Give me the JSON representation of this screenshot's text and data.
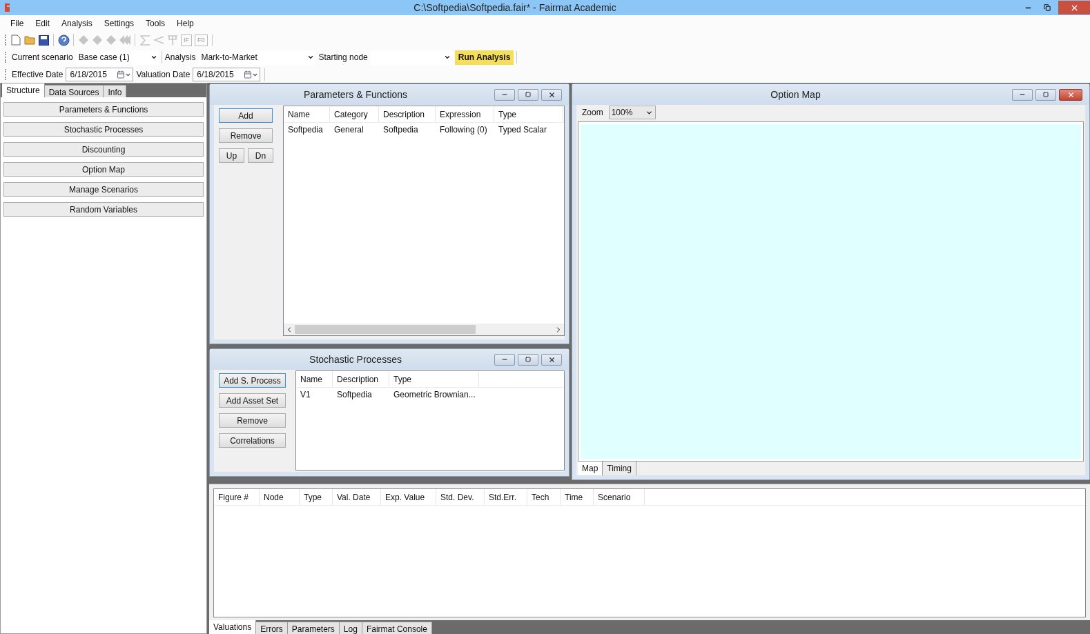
{
  "window": {
    "title": "C:\\Softpedia\\Softpedia.fair* - Fairmat Academic"
  },
  "menu": [
    "File",
    "Edit",
    "Analysis",
    "Settings",
    "Tools",
    "Help"
  ],
  "toolbar": [
    {
      "kind": "new",
      "disabled": false
    },
    {
      "kind": "open",
      "disabled": false
    },
    {
      "kind": "save",
      "disabled": false
    },
    {
      "kind": "separator"
    },
    {
      "kind": "help",
      "disabled": false
    },
    {
      "kind": "separator"
    },
    {
      "kind": "diamond",
      "disabled": true
    },
    {
      "kind": "diamond",
      "disabled": true
    },
    {
      "kind": "diamond",
      "disabled": true
    },
    {
      "kind": "rewind",
      "disabled": true
    },
    {
      "kind": "separator"
    },
    {
      "kind": "sigma",
      "disabled": true
    },
    {
      "kind": "branch",
      "disabled": true
    },
    {
      "kind": "tree",
      "disabled": true
    },
    {
      "kind": "label",
      "text": "IF",
      "disabled": true
    },
    {
      "kind": "label",
      "text": "F0",
      "disabled": true
    }
  ],
  "scenario_bar": {
    "current_scenario": {
      "label": "Current scenario",
      "value": "Base case (1)"
    },
    "analysis": {
      "label": "Analysis",
      "value": "Mark-to-Market"
    },
    "starting_node": {
      "label": "Starting node"
    },
    "run_button": "Run Analysis"
  },
  "date_bar": {
    "effective_date": {
      "label": "Effective Date",
      "value": "6/18/2015"
    },
    "valuation_date": {
      "label": "Valuation Date",
      "value": "6/18/2015"
    }
  },
  "sidebar": {
    "tabs": [
      {
        "label": "Structure",
        "selected": true
      },
      {
        "label": "Data Sources",
        "selected": false
      },
      {
        "label": "Info",
        "selected": false
      }
    ],
    "items": [
      "Parameters & Functions",
      "Stochastic Processes",
      "Discounting",
      "Option Map",
      "Manage Scenarios",
      "Random Variables"
    ]
  },
  "parameters_window": {
    "title": "Parameters & Functions",
    "buttons": [
      {
        "label": "Add",
        "focused": true
      },
      {
        "label": "Remove",
        "focused": false
      }
    ],
    "nav_buttons": [
      "Up",
      "Dn"
    ],
    "columns": [
      "Name",
      "Category",
      "Description",
      "Expression",
      "Type"
    ],
    "rows": [
      [
        "Softpedia",
        "General",
        "Softpedia",
        "Following (0)",
        "Typed Scalar"
      ]
    ]
  },
  "stochastic_window": {
    "title": "Stochastic Processes",
    "buttons": [
      {
        "label": "Add S. Process",
        "focused": true
      },
      {
        "label": "Add Asset Set",
        "focused": false
      },
      {
        "label": "Remove",
        "focused": false
      },
      {
        "label": "Correlations",
        "focused": false
      }
    ],
    "columns": [
      "Name",
      "Description",
      "Type"
    ],
    "rows": [
      [
        "V1",
        "Softpedia",
        "Geometric Brownian..."
      ]
    ]
  },
  "option_map_window": {
    "title": "Option Map",
    "zoom_label": "Zoom",
    "zoom_value": "100%",
    "tabs": [
      {
        "label": "Map",
        "selected": true
      },
      {
        "label": "Timing",
        "selected": false
      }
    ]
  },
  "results": {
    "columns": [
      "Figure #",
      "Node",
      "Type",
      "Val. Date",
      "Exp. Value",
      "Std. Dev.",
      "Std.Err.",
      "Tech",
      "Time",
      "Scenario"
    ],
    "tabs": [
      {
        "label": "Valuations",
        "selected": true
      },
      {
        "label": "Errors",
        "selected": false
      },
      {
        "label": "Parameters",
        "selected": false
      },
      {
        "label": "Log",
        "selected": false
      },
      {
        "label": "Fairmat Console",
        "selected": false
      }
    ]
  }
}
